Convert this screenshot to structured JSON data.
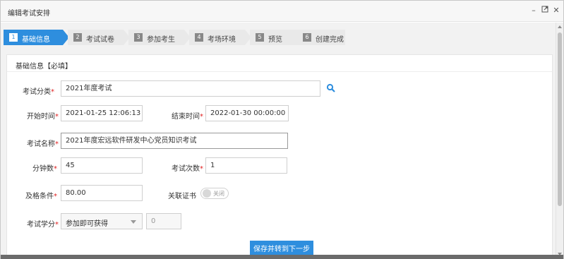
{
  "window": {
    "title": "编辑考试安排",
    "controls": {
      "minimize_icon": "minimize-icon",
      "maximize_icon": "maximize-icon",
      "close_icon": "close-icon"
    }
  },
  "steps": [
    {
      "num": "1",
      "label": "基础信息",
      "active": true
    },
    {
      "num": "2",
      "label": "考试试卷",
      "active": false
    },
    {
      "num": "3",
      "label": "参加考生",
      "active": false
    },
    {
      "num": "4",
      "label": "考场环境",
      "active": false
    },
    {
      "num": "5",
      "label": "预览",
      "active": false
    },
    {
      "num": "6",
      "label": "创建完成",
      "active": false
    }
  ],
  "panel": {
    "title": "基础信息【必填】"
  },
  "form": {
    "category": {
      "label": "考试分类",
      "required": "*",
      "value": "2021年度考试"
    },
    "start_time": {
      "label": "开始时间",
      "required": "*",
      "value": "2021-01-25 12:06:13"
    },
    "end_time": {
      "label": "结束时间",
      "required": "*",
      "value": "2022-01-30 00:00:00"
    },
    "exam_name": {
      "label": "考试名称",
      "required": "*",
      "value": "2021年度宏远软件研发中心党员知识考试"
    },
    "minutes": {
      "label": "分钟数",
      "required": "*",
      "value": "45"
    },
    "attempts": {
      "label": "考试次数",
      "required": "*",
      "value": "1"
    },
    "pass_score": {
      "label": "及格条件",
      "required": "*",
      "value": "80.00"
    },
    "certificate": {
      "label": "关联证书",
      "toggle_text": "关闭"
    },
    "credits": {
      "label": "考试学分",
      "required": "*",
      "select_value": "参加即可获得",
      "amount_value": "0"
    }
  },
  "actions": {
    "save_next": "保存并转到下一步"
  },
  "colors": {
    "accent": "#2e8ede",
    "required": "#e02020"
  }
}
